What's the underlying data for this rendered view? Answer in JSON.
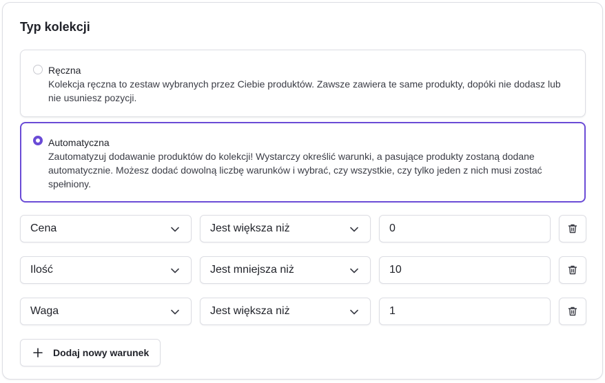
{
  "section": {
    "title": "Typ kolekcji"
  },
  "options": {
    "manual": {
      "title": "Ręczna",
      "description": "Kolekcja ręczna to zestaw wybranych przez Ciebie produktów. Zawsze zawiera te same produkty, dopóki nie dodasz lub nie usuniesz pozycji.",
      "selected": false
    },
    "automatic": {
      "title": "Automatyczna",
      "description": "Zautomatyzuj dodawanie produktów do kolekcji! Wystarczy określić warunki, a pasujące produkty zostaną dodane automatycznie. Możesz dodać dowolną liczbę warunków i wybrać, czy wszystkie, czy tylko jeden z nich musi zostać spełniony.",
      "selected": true
    }
  },
  "conditions": [
    {
      "field": "Cena",
      "operator": "Jest większa niż",
      "value": "0"
    },
    {
      "field": "Ilość",
      "operator": "Jest mniejsza niż",
      "value": "10"
    },
    {
      "field": "Waga",
      "operator": "Jest większa niż",
      "value": "1"
    }
  ],
  "icons": {
    "dropdown": "chevron-down-icon",
    "delete": "trash-icon",
    "add": "plus-icon"
  },
  "add_condition_label": "Dodaj nowy warunek",
  "colors": {
    "accent": "#6a4bd6",
    "border": "#dcdde3",
    "text": "#1f2128"
  }
}
